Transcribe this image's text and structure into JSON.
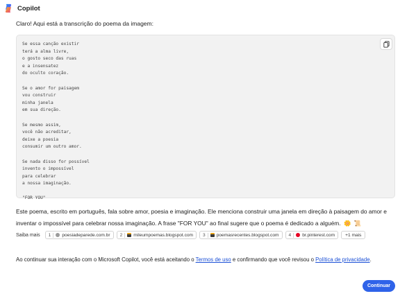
{
  "header": {
    "title": "Copilot",
    "logo_icon": "copilot-logo-icon"
  },
  "intro": "Claro! Aqui está a transcrição do poema da imagem:",
  "code_block": {
    "copy_icon": "copy-icon",
    "stanzas": [
      [
        "Se essa canção existir",
        "terá a alma livre,",
        "o gosto seco das ruas",
        "e a insensatez",
        "do oculto coração."
      ],
      [
        "Se o amor for paisagem",
        "vou construir",
        "minha janela",
        "em sua direção."
      ],
      [
        "Se mesmo assim,",
        "você não acreditar,",
        "deixe a poesia",
        "consumir um outro amor."
      ],
      [
        "Se nada disso for possível",
        "invento o impossível",
        "para celebrar",
        "a nossa imaginação."
      ],
      [
        "\"FOR YOU\""
      ]
    ]
  },
  "paragraph": {
    "text": "Este poema, escrito em português, fala sobre amor, poesia e imaginação. Ele menciona construir uma janela em direção à paisagem do amor e inventar o impossível para celebrar nossa imaginação. A frase \"FOR YOU\" ao final sugere que o poema é dedicado a alguém.",
    "emoji_1": "🌼",
    "emoji_2": "📜"
  },
  "sources": {
    "label": "Saiba mais",
    "items": [
      {
        "num": "1",
        "domain": "poesiadeparede.com.br",
        "fav_color": "#9b9b9b"
      },
      {
        "num": "2",
        "domain": "mileumpoemas.blogspot.com",
        "fav_color": "#3a3a3a"
      },
      {
        "num": "3",
        "domain": "poemasrecentes.blogspot.com",
        "fav_color": "#3a3a3a"
      },
      {
        "num": "4",
        "domain": "br.pinterest.com",
        "fav_color": "#e60023"
      }
    ],
    "more": "+1 mais"
  },
  "consent": {
    "prefix": "Ao continuar sua interação com o Microsoft Copilot, você está aceitando o ",
    "terms_link": "Termos de uso",
    "middle": " e confirmando que você revisou o ",
    "privacy_link": "Política de privacidade",
    "suffix": "."
  },
  "continue_button": "Continuar"
}
